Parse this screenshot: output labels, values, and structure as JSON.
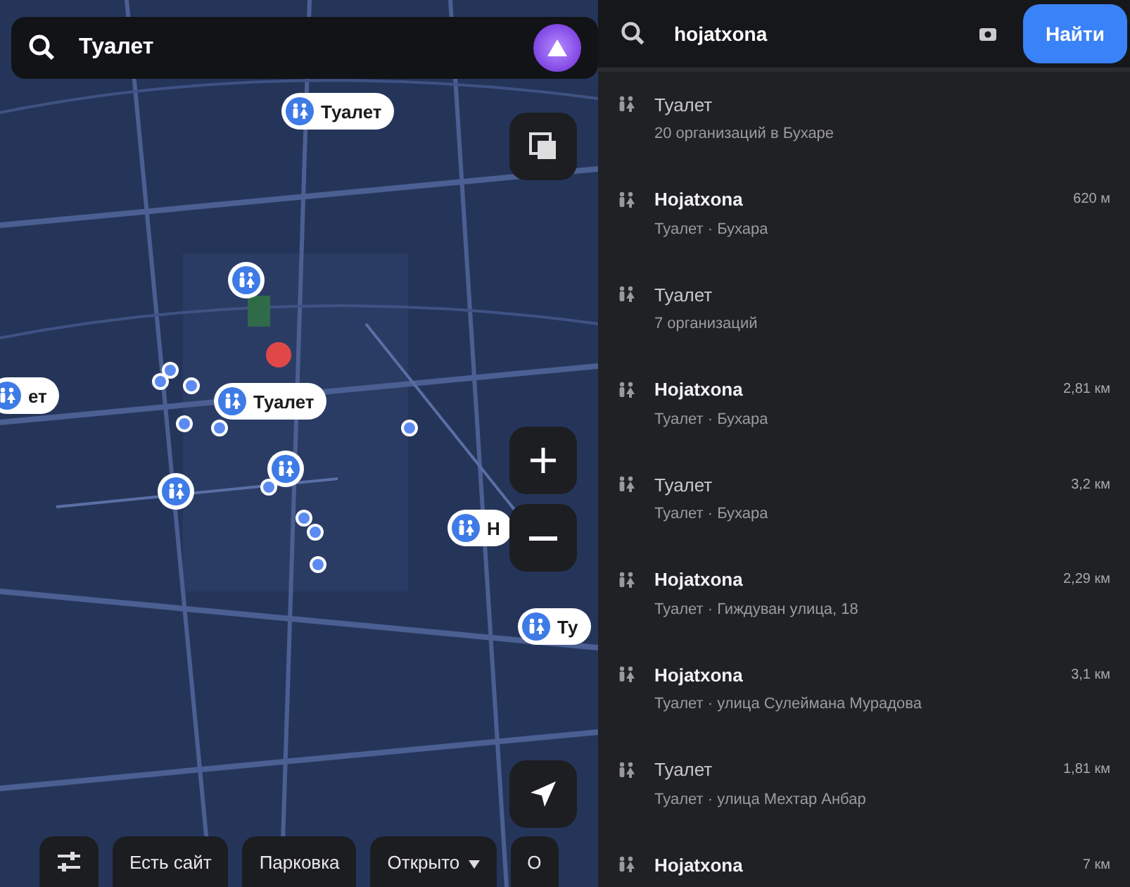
{
  "map_panel": {
    "search": {
      "value": "Туалет"
    },
    "pins": [
      {
        "label": "Туалет"
      },
      {
        "label": "Туалет"
      },
      {
        "label": "ет"
      },
      {
        "label": "H"
      },
      {
        "label": "Ту"
      }
    ],
    "filters": [
      {
        "label": "Есть сайт",
        "dropdown": false
      },
      {
        "label": "Парковка",
        "dropdown": false
      },
      {
        "label": "Открыто",
        "dropdown": true
      },
      {
        "label": "О",
        "dropdown": false
      }
    ]
  },
  "results_panel": {
    "search": {
      "value": "hojatxona"
    },
    "find_button": "Найти",
    "results": [
      {
        "title": "Туалет",
        "subtitle": "20 организаций в Бухаре",
        "bold": false
      },
      {
        "title": "Hojatxona",
        "subtitle": "Туалет · Бухара",
        "distance": "620 м",
        "bold": true
      },
      {
        "title": "Туалет",
        "subtitle": "7 организаций",
        "bold": false
      },
      {
        "title": "Hojatxona",
        "subtitle": "Туалет · Бухара",
        "distance": "2,81 км",
        "bold": true
      },
      {
        "title": "Туалет",
        "subtitle": "Туалет · Бухара",
        "distance": "3,2 км",
        "bold": false
      },
      {
        "title": "Hojatxona",
        "subtitle": "Туалет · Гиждуван улица, 18",
        "distance": "2,29 км",
        "bold": true
      },
      {
        "title": "Hojatxona",
        "subtitle": "Туалет · улица Сулеймана Мурадова",
        "distance": "3,1 км",
        "bold": true
      },
      {
        "title": "Туалет",
        "subtitle": "Туалет · улица Мехтар Анбар",
        "distance": "1,81 км",
        "bold": false
      },
      {
        "title": "Hojatxona",
        "distance": "7 км",
        "bold": true
      }
    ]
  }
}
